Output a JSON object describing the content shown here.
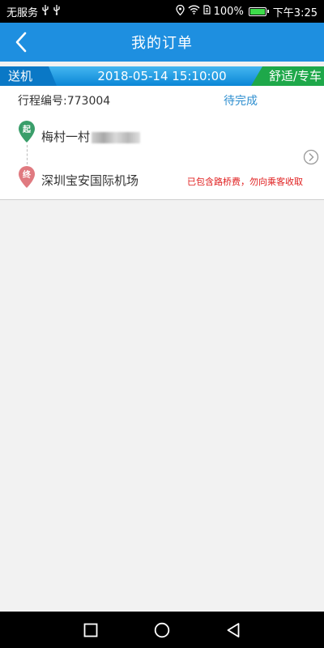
{
  "status_bar": {
    "carrier": "无服务",
    "battery": "100%",
    "battery_level": 1.0,
    "time": "下午3:25"
  },
  "header": {
    "title": "我的订单"
  },
  "order": {
    "trip_type": "送机",
    "datetime": "2018-05-14 15:10:00",
    "car_type": "舒适/专车",
    "trip_number": "行程编号:773004",
    "status": "待完成",
    "start_marker": "起",
    "end_marker": "终",
    "origin": "梅村一村",
    "destination": "深圳宝安国际机场",
    "note": "已包含路桥费，勿向乘客收取"
  },
  "colors": {
    "header_bg": "#1e8fe0",
    "start_marker": "#3a9e6a",
    "end_marker": "#e07a80",
    "status_text": "#2f8fd0",
    "note_text": "#e02020"
  }
}
